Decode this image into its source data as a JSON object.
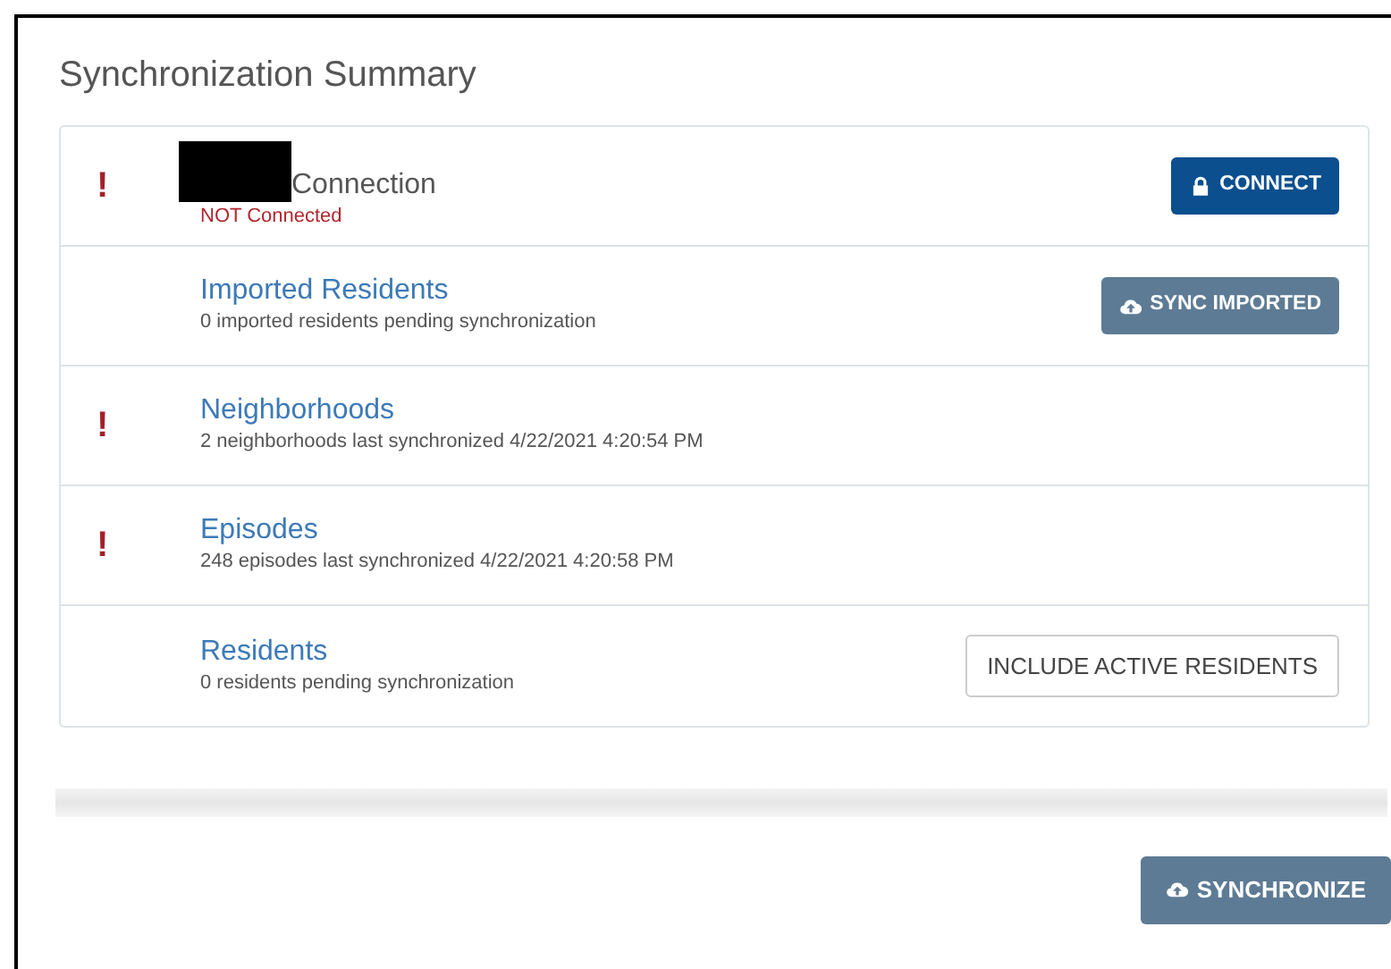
{
  "title": "Synchronization Summary",
  "items": [
    {
      "marker": "!",
      "redacted": true,
      "link": false,
      "title": "Connection",
      "status": "NOT Connected",
      "error": true,
      "button": {
        "label": "CONNECT",
        "kind": "connect"
      }
    },
    {
      "redacted": false,
      "link": true,
      "title": "Imported Residents",
      "status": "0 imported residents pending synchronization",
      "error": false,
      "button": {
        "label": "SYNC IMPORTED",
        "kind": "sync"
      }
    },
    {
      "marker": "!",
      "redacted": false,
      "link": true,
      "title": "Neighborhoods",
      "status": "2 neighborhoods last synchronized 4/22/2021 4:20:54 PM",
      "error": false
    },
    {
      "marker": "!",
      "redacted": false,
      "link": true,
      "title": "Episodes",
      "status": "248 episodes last synchronized 4/22/2021 4:20:58 PM",
      "error": false
    },
    {
      "redacted": false,
      "link": true,
      "title": "Residents",
      "status": "0 residents pending synchronization",
      "error": false,
      "button": {
        "label": "INCLUDE ACTIVE RESIDENTS",
        "kind": "option"
      }
    }
  ],
  "footer_button": {
    "label": "SYNCHRONIZE",
    "kind": "sync"
  }
}
